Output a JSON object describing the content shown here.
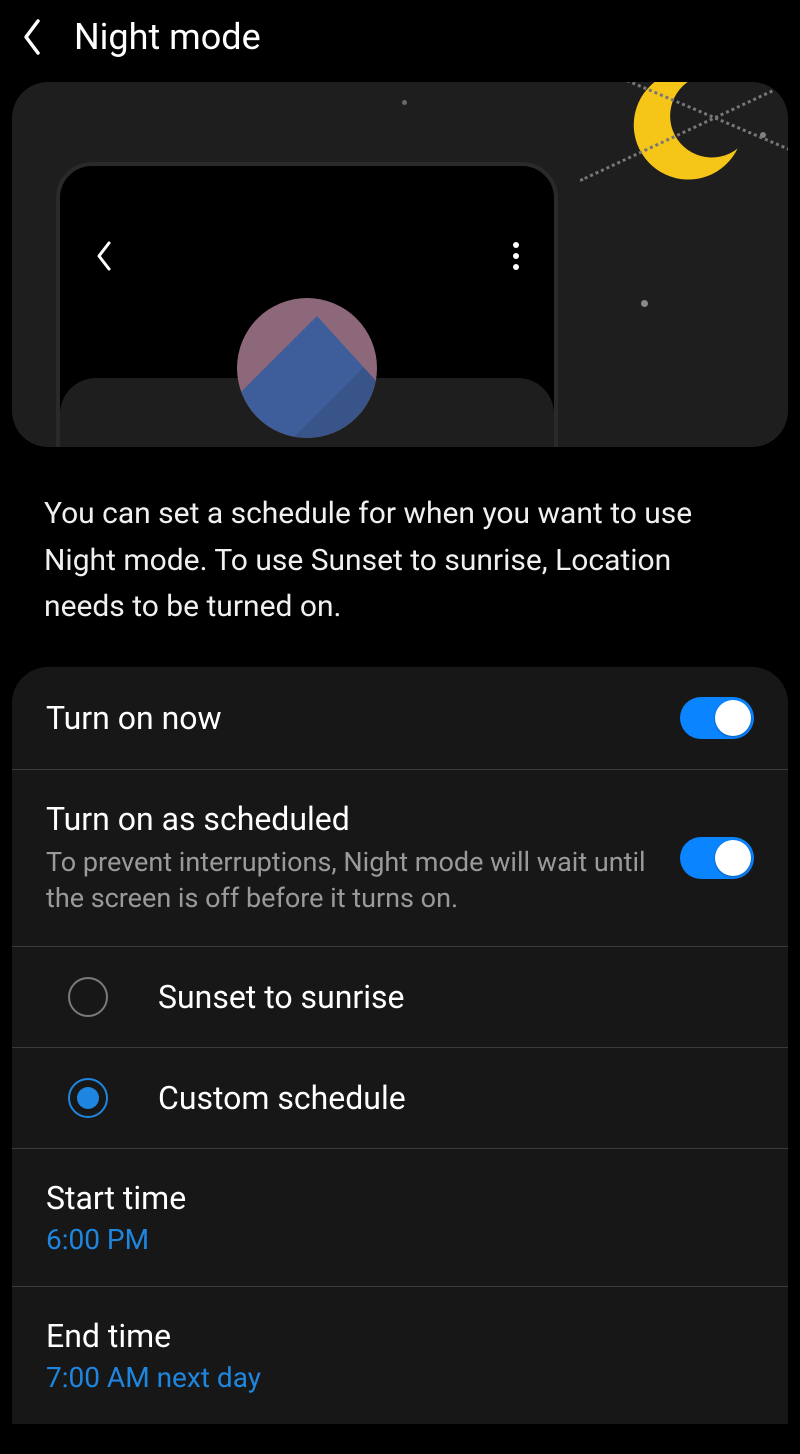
{
  "header": {
    "title": "Night mode"
  },
  "description": "You can set a schedule for when you want to use Night mode. To use Sunset to sunrise, Location needs to be turned on.",
  "options": {
    "turn_on_now": {
      "label": "Turn on now",
      "enabled": true
    },
    "scheduled": {
      "label": "Turn on as scheduled",
      "sub": "To prevent interruptions, Night mode will wait until the screen is off before it turns on.",
      "enabled": true
    },
    "radio": {
      "sunset": "Sunset to sunrise",
      "custom": "Custom schedule",
      "selected": "custom"
    },
    "start": {
      "label": "Start time",
      "value": "6:00 PM"
    },
    "end": {
      "label": "End time",
      "value": "7:00 AM next day"
    }
  }
}
